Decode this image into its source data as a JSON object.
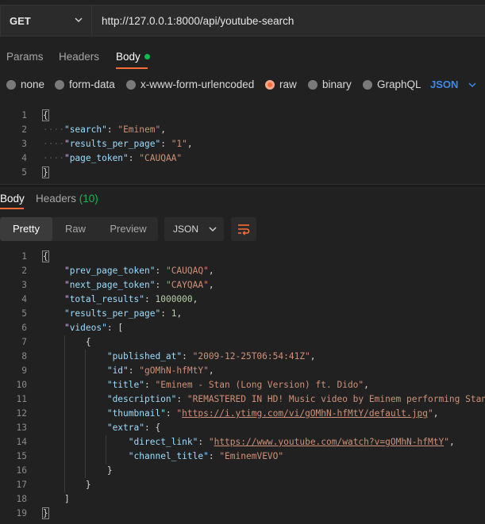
{
  "request": {
    "method": "GET",
    "url": "http://127.0.0.1:8000/api/youtube-search"
  },
  "request_tabs": [
    {
      "label": "Params"
    },
    {
      "label": "Headers"
    },
    {
      "label": "Body"
    }
  ],
  "body_types": [
    {
      "label": "none"
    },
    {
      "label": "form-data"
    },
    {
      "label": "x-www-form-urlencoded"
    },
    {
      "label": "raw"
    },
    {
      "label": "binary"
    },
    {
      "label": "GraphQL"
    }
  ],
  "body_format": "JSON",
  "request_body": {
    "search_key": "\"search\"",
    "search_val": "\"Eminem\"",
    "rpp_key": "\"results_per_page\"",
    "rpp_val": "\"1\"",
    "token_key": "\"page_token\"",
    "token_val": "\"CAUQAA\""
  },
  "response_tabs": {
    "body": "Body",
    "headers": "Headers",
    "headers_count": "(10)"
  },
  "response_toolbar": {
    "pretty": "Pretty",
    "raw": "Raw",
    "preview": "Preview",
    "format": "JSON"
  },
  "response_body": {
    "prev_key": "\"prev_page_token\"",
    "prev_val": "\"CAUQAQ\"",
    "next_key": "\"next_page_token\"",
    "next_val": "\"CAYQAA\"",
    "total_key": "\"total_results\"",
    "total_val": "1000000",
    "rpp_key": "\"results_per_page\"",
    "rpp_val": "1",
    "videos_key": "\"videos\"",
    "published_key": "\"published_at\"",
    "published_val": "\"2009-12-25T06:54:41Z\"",
    "id_key": "\"id\"",
    "id_val": "\"gOMhN-hfMtY\"",
    "title_key": "\"title\"",
    "title_val": "\"Eminem - Stan (Long Version) ft. Dido\"",
    "desc_key": "\"description\"",
    "desc_val": "\"REMASTERED IN HD! Music video by Eminem performing Stan.",
    "thumb_key": "\"thumbnail\"",
    "thumb_val": "https://i.ytimg.com/vi/gOMhN-hfMtY/default.jpg",
    "extra_key": "\"extra\"",
    "link_key": "\"direct_link\"",
    "link_val": "https://www.youtube.com/watch?v=gOMhN-hfMtY",
    "channel_key": "\"channel_title\"",
    "channel_val": "\"EminemVEVO\""
  },
  "line_numbers": [
    "1",
    "2",
    "3",
    "4",
    "5",
    "6",
    "7",
    "8",
    "9",
    "10",
    "11",
    "12",
    "13",
    "14",
    "15",
    "16",
    "17",
    "18",
    "19"
  ],
  "colors": {
    "accent": "#ff6c37",
    "link": "#3d8ae8",
    "success": "#0cbb52"
  }
}
